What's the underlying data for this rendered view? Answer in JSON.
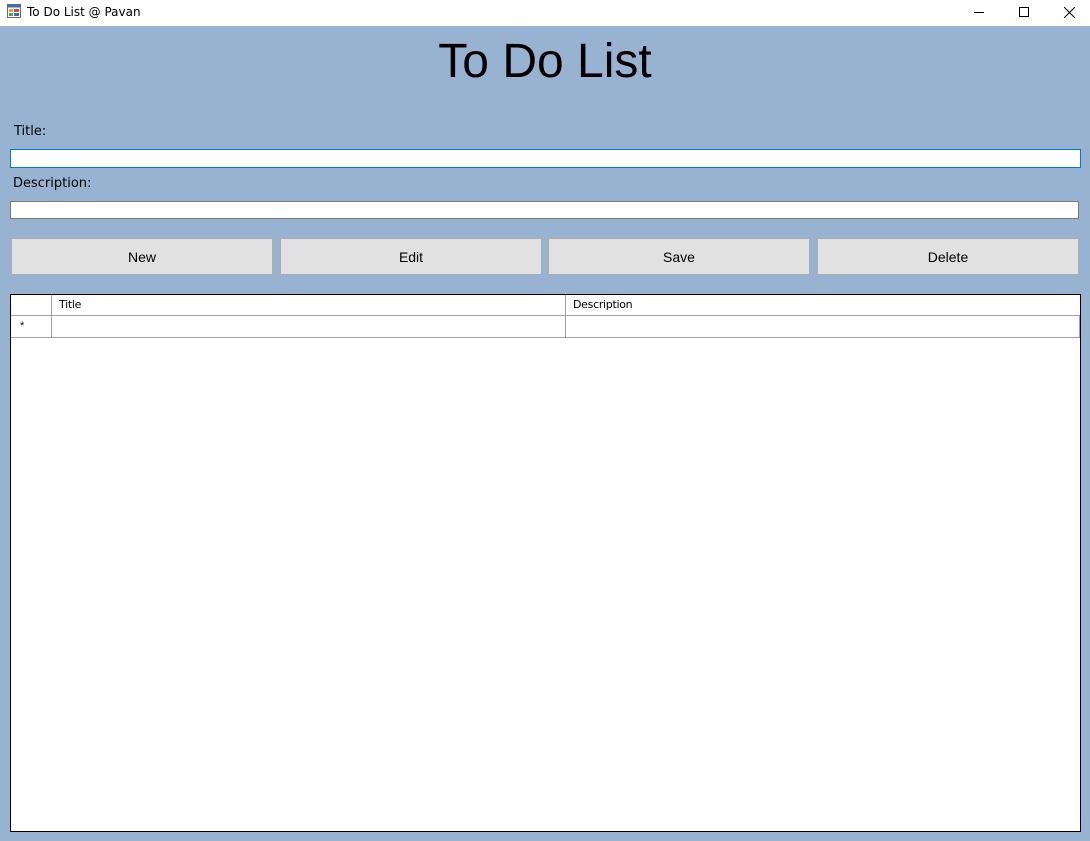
{
  "window": {
    "title": "To Do List @ Pavan",
    "app_icon": "app-form-icon",
    "controls": [
      "minimize-icon",
      "maximize-icon",
      "close-icon"
    ]
  },
  "form": {
    "heading": "To Do List",
    "title_label": "Title:",
    "title_value": "",
    "description_label": "Description:",
    "description_value": ""
  },
  "buttons": {
    "new": "New",
    "edit": "Edit",
    "save": "Save",
    "delete": "Delete"
  },
  "grid": {
    "columns": [
      "Title",
      "Description"
    ],
    "rows": [],
    "new_row_marker": "*"
  },
  "colors": {
    "form_background": "#98b3d1",
    "focus_border": "#0078d7",
    "button_background": "#e1e1e1"
  }
}
